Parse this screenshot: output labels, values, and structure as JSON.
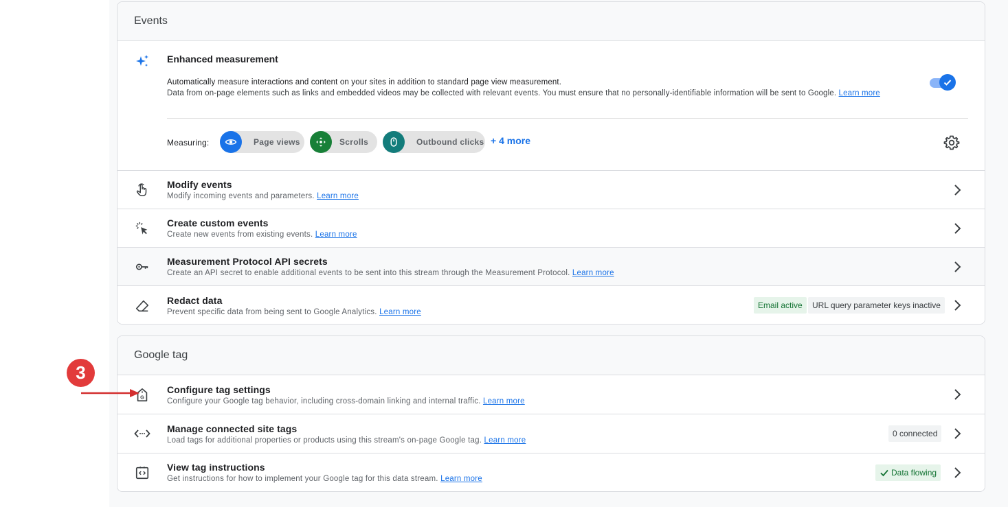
{
  "events": {
    "header": "Events",
    "enhanced": {
      "title": "Enhanced measurement",
      "line1": "Automatically measure interactions and content on your sites in addition to standard page view measurement.",
      "line2": "Data from on-page elements such as links and embedded videos may be collected with relevant events. You must ensure that no personally-identifiable information will be sent to Google.",
      "learn_more": "Learn more",
      "toggle_on": true,
      "measuring_label": "Measuring:",
      "chips": [
        {
          "label": "Page views",
          "color": "#1a73e8",
          "icon": "eye-icon"
        },
        {
          "label": "Scrolls",
          "color": "#188038",
          "icon": "scroll-arrows-icon"
        },
        {
          "label": "Outbound clicks",
          "color": "#137c7b",
          "icon": "mouse-icon"
        }
      ],
      "more": "+ 4 more"
    },
    "rows": [
      {
        "title": "Modify events",
        "desc": "Modify incoming events and parameters.",
        "link": "Learn more",
        "icon": "touch-hand-icon"
      },
      {
        "title": "Create custom events",
        "desc": "Create new events from existing events.",
        "link": "Learn more",
        "icon": "click-sparkle-icon"
      },
      {
        "title": "Measurement Protocol API secrets",
        "desc": "Create an API secret to enable additional events to be sent into this stream through the Measurement Protocol.",
        "link": "Learn more",
        "icon": "key-icon"
      },
      {
        "title": "Redact data",
        "desc": "Prevent specific data from being sent to Google Analytics.",
        "link": "Learn more",
        "icon": "eraser-icon",
        "badges": [
          "Email active",
          "URL query parameter keys inactive"
        ]
      }
    ]
  },
  "google_tag": {
    "header": "Google tag",
    "rows": [
      {
        "title": "Configure tag settings",
        "desc": "Configure your Google tag behavior, including cross-domain linking and internal traffic.",
        "link": "Learn more",
        "icon": "google-tag-icon"
      },
      {
        "title": "Manage connected site tags",
        "desc": "Load tags for additional properties or products using this stream's on-page Google tag.",
        "link": "Learn more",
        "icon": "code-arrows-icon",
        "badge": "0 connected"
      },
      {
        "title": "View tag instructions",
        "desc": "Get instructions for how to implement your Google tag for this data stream.",
        "link": "Learn more",
        "icon": "code-box-icon",
        "badge": "Data flowing"
      }
    ]
  },
  "annotation": {
    "step": "3"
  },
  "colors": {
    "accent": "#1a73e8",
    "marker": "#e23b3b",
    "success_bg": "#e6f4ea",
    "success_text": "#137333"
  }
}
